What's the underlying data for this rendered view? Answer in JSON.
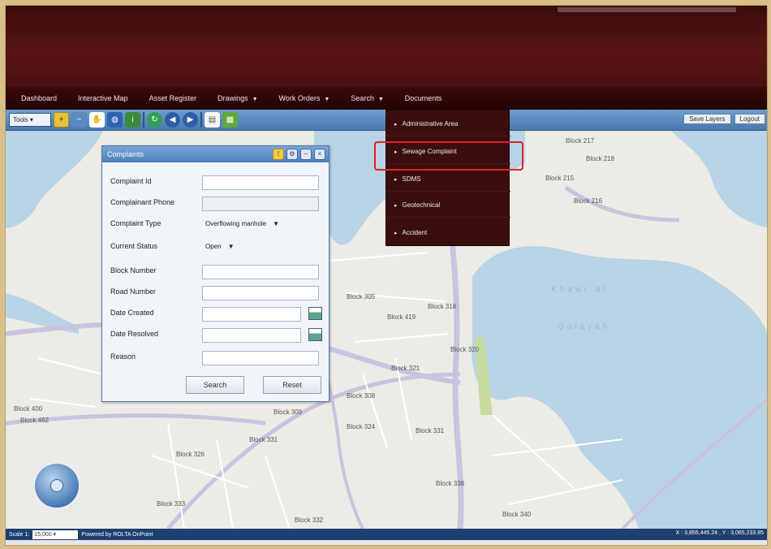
{
  "nav": {
    "items": [
      {
        "label": "Dashboard",
        "caret": false
      },
      {
        "label": "Interactive Map",
        "caret": false
      },
      {
        "label": "Asset Register",
        "caret": false
      },
      {
        "label": "Drawings",
        "caret": true
      },
      {
        "label": "Work Orders",
        "caret": true
      },
      {
        "label": "Search",
        "caret": true
      },
      {
        "label": "Documents",
        "caret": false
      }
    ]
  },
  "toolbar": {
    "tools_select": "Tools",
    "save_layers": "Save Layers",
    "logout": "Logout"
  },
  "search_menu": {
    "items": [
      "Administrative Area",
      "Sewage Complaint",
      "SDMS",
      "Geotechnical",
      "Accident"
    ],
    "highlighted": "Sewage Complaint"
  },
  "dialog": {
    "title": "Complaints",
    "fields": [
      {
        "label": "Complaint Id",
        "value": "",
        "type": "text"
      },
      {
        "label": "Complainant Phone",
        "value": "",
        "type": "text-disabled"
      },
      {
        "label": "Complaint Type",
        "value": "Overflowing manhole",
        "type": "select"
      },
      {
        "label": "Current Status",
        "value": "Open",
        "type": "select"
      },
      {
        "label": "Block Number",
        "value": "",
        "type": "text"
      },
      {
        "label": "Road Number",
        "value": "",
        "type": "text"
      },
      {
        "label": "Date Created",
        "value": "",
        "type": "date"
      },
      {
        "label": "Date Resolved",
        "value": "",
        "type": "date"
      },
      {
        "label": "Reason",
        "value": "",
        "type": "text"
      }
    ],
    "search_button": "Search",
    "reset_button": "Reset"
  },
  "map": {
    "labels": [
      "Block 217",
      "Block 218",
      "Block 215",
      "Block 216",
      "Block 305",
      "Block 318",
      "Block 320",
      "Block 321",
      "Block 308",
      "Block 324",
      "Block 309",
      "Block 326",
      "Block 331",
      "Block 338",
      "Block 333",
      "Block 340",
      "Block 332",
      "Block 462",
      "Block 400",
      "Block 419",
      "Block 331"
    ],
    "bay_label_1": "Khawr al",
    "bay_label_2": "Qulayah"
  },
  "status": {
    "scale_label": "Scale 1:",
    "scale_value": "15,000",
    "powered_by": "Powered by ROLTA OnPoint",
    "coords": "X : 3,855,445.24 ,  Y : 3,065,233.85"
  },
  "colors": {
    "banner": "#4a1010",
    "nav_bg": "#2a0606",
    "toolbar": "#4a78ae",
    "highlight": "#e0202a",
    "water": "#b8d4e6"
  }
}
